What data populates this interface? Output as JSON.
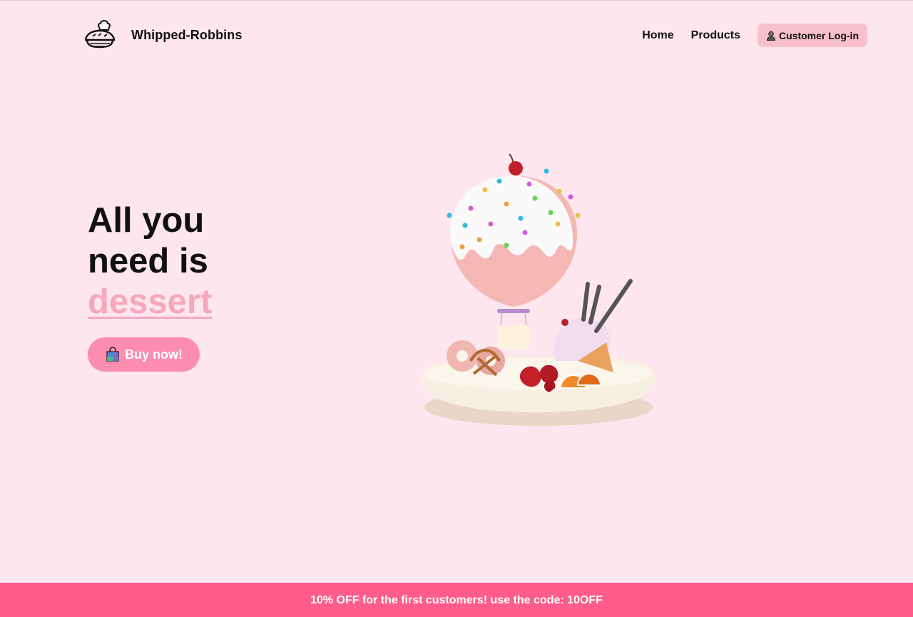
{
  "brand": {
    "name": "Whipped-Robbins",
    "logo_icon": "pie-chef-hat-icon"
  },
  "nav": {
    "items": [
      {
        "label": "Home"
      },
      {
        "label": "Products"
      }
    ],
    "login": {
      "label": "Customer Log-in",
      "icon": "person-icon"
    }
  },
  "hero": {
    "line1": "All you",
    "line2": "need is",
    "accent": "dessert",
    "accent_color": "#f6a8bd",
    "cta": {
      "label": "Buy now!",
      "icon": "shopping-bag-icon",
      "color": "#fc8db0"
    },
    "illustration": "hot-air-balloon-dessert-illustration"
  },
  "promo": {
    "text": "10% OFF for the first customers! use the code: 10OFF",
    "color": "#ff5b8b"
  },
  "colors": {
    "background": "#fee6ee",
    "login_button": "#f8bfcd"
  }
}
